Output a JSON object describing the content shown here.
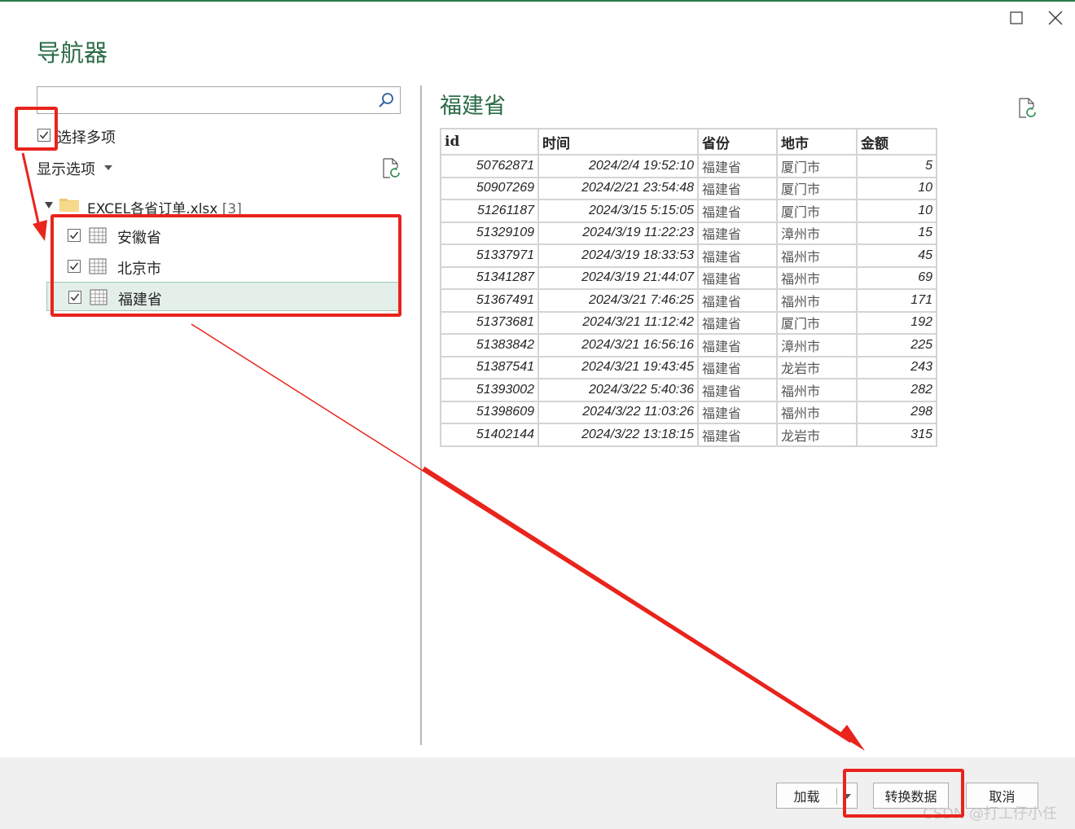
{
  "window": {
    "title": "导航器",
    "maximize_icon": "maximize-icon",
    "close_icon": "close-icon"
  },
  "left_pane": {
    "search": {
      "value": "",
      "placeholder": "",
      "icon": "search-icon"
    },
    "select_multiple": {
      "label": "选择多项",
      "checked": true
    },
    "display_options": {
      "label": "显示选项"
    },
    "tree": {
      "root": {
        "label": "EXCEL各省订单.xlsx",
        "count": "[3]",
        "icon": "folder-icon"
      },
      "items": [
        {
          "label": "安徽省",
          "checked": true,
          "selected": false,
          "icon": "table-icon"
        },
        {
          "label": "北京市",
          "checked": true,
          "selected": false,
          "icon": "table-icon"
        },
        {
          "label": "福建省",
          "checked": true,
          "selected": true,
          "icon": "table-icon"
        }
      ]
    }
  },
  "right_pane": {
    "title": "福建省",
    "table": {
      "columns": [
        "id",
        "时间",
        "省份",
        "地市",
        "金额"
      ],
      "rows": [
        [
          "50762871",
          "2024/2/4 19:52:10",
          "福建省",
          "厦门市",
          "5"
        ],
        [
          "50907269",
          "2024/2/21 23:54:48",
          "福建省",
          "厦门市",
          "10"
        ],
        [
          "51261187",
          "2024/3/15 5:15:05",
          "福建省",
          "厦门市",
          "10"
        ],
        [
          "51329109",
          "2024/3/19 11:22:23",
          "福建省",
          "漳州市",
          "15"
        ],
        [
          "51337971",
          "2024/3/19 18:33:53",
          "福建省",
          "福州市",
          "45"
        ],
        [
          "51341287",
          "2024/3/19 21:44:07",
          "福建省",
          "福州市",
          "69"
        ],
        [
          "51367491",
          "2024/3/21 7:46:25",
          "福建省",
          "福州市",
          "171"
        ],
        [
          "51373681",
          "2024/3/21 11:12:42",
          "福建省",
          "厦门市",
          "192"
        ],
        [
          "51383842",
          "2024/3/21 16:56:16",
          "福建省",
          "漳州市",
          "225"
        ],
        [
          "51387541",
          "2024/3/21 19:43:45",
          "福建省",
          "龙岩市",
          "243"
        ],
        [
          "51393002",
          "2024/3/22 5:40:36",
          "福建省",
          "福州市",
          "282"
        ],
        [
          "51398609",
          "2024/3/22 11:03:26",
          "福建省",
          "福州市",
          "298"
        ],
        [
          "51402144",
          "2024/3/22 13:18:15",
          "福建省",
          "龙岩市",
          "315"
        ]
      ]
    }
  },
  "footer": {
    "load_label": "加载",
    "transform_label": "转换数据",
    "cancel_label": "取消"
  },
  "watermark": "CSDN @打工仔小任",
  "colors": {
    "accent_green": "#2b6b45",
    "annotation_red": "#e8241c",
    "selection_bg": "#e3efe8"
  }
}
